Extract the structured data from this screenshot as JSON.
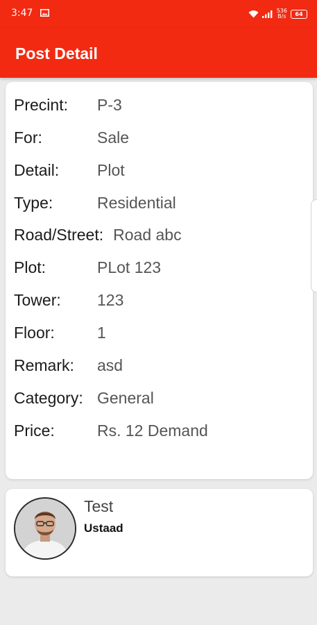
{
  "status_bar": {
    "time": "3:47",
    "speed_value": "536",
    "speed_unit": "B/s",
    "battery": "64"
  },
  "header": {
    "title": "Post Detail"
  },
  "details": [
    {
      "label": "Precint:",
      "value": "P-3"
    },
    {
      "label": "For:",
      "value": "Sale"
    },
    {
      "label": "Detail:",
      "value": "Plot"
    },
    {
      "label": "Type:",
      "value": "Residential"
    },
    {
      "label": "Road/Street:",
      "value": "Road abc"
    },
    {
      "label": "Plot:",
      "value": "PLot 123"
    },
    {
      "label": "Tower:",
      "value": "123"
    },
    {
      "label": "Floor:",
      "value": "1"
    },
    {
      "label": "Remark:",
      "value": "asd"
    },
    {
      "label": "Category:",
      "value": "General"
    },
    {
      "label": "Price:",
      "value": "Rs. 12 Demand"
    }
  ],
  "user": {
    "name": "Test",
    "role": "Ustaad"
  },
  "colors": {
    "accent": "#f22a12",
    "background": "#ebebeb"
  }
}
